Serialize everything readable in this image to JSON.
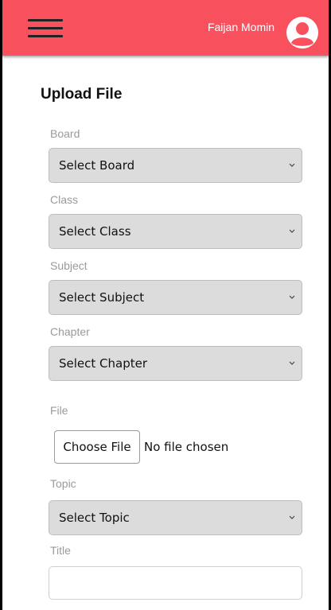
{
  "header": {
    "menu_icon": "hamburger-menu-icon",
    "user_name": "Faijan Momin",
    "avatar_icon": "user-avatar-icon",
    "background_color": "#f8515d"
  },
  "form": {
    "title": "Upload File",
    "board": {
      "label": "Board",
      "selected": "Select Board"
    },
    "class": {
      "label": "Class",
      "selected": "Select Class"
    },
    "subject": {
      "label": "Subject",
      "selected": "Select Subject"
    },
    "chapter": {
      "label": "Chapter",
      "selected": "Select Chapter"
    },
    "file": {
      "label": "File",
      "button": "Choose File",
      "status": "No file chosen"
    },
    "topic": {
      "label": "Topic",
      "selected": "Select Topic"
    },
    "title_field": {
      "label": "Title",
      "value": ""
    }
  }
}
